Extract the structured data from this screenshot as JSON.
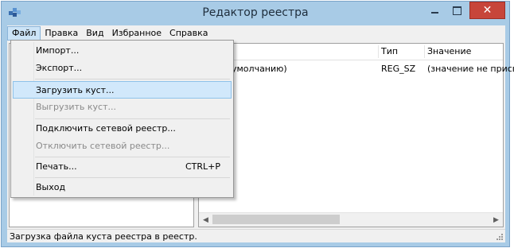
{
  "window": {
    "title": "Редактор реестра"
  },
  "menubar": {
    "items": [
      "Файл",
      "Правка",
      "Вид",
      "Избранное",
      "Справка"
    ]
  },
  "file_menu": {
    "import": "Импорт...",
    "export": "Экспорт...",
    "load_hive": "Загрузить куст...",
    "unload_hive": "Выгрузить куст...",
    "connect_network": "Подключить сетевой реестр...",
    "disconnect_network": "Отключить сетевой реестр...",
    "print": "Печать...",
    "print_shortcut": "CTRL+P",
    "exit": "Выход"
  },
  "list": {
    "columns": {
      "type": "Тип",
      "value": "Значение"
    },
    "rows": [
      {
        "name": "умолчанию)",
        "type": "REG_SZ",
        "value": "(значение не присв"
      }
    ]
  },
  "statusbar": {
    "text": "Загрузка файла куста реестра в реестр."
  },
  "colors": {
    "frame": "#a8cbe6",
    "close_button": "#c7453a",
    "highlight": "#d1e8fb"
  },
  "icons": [
    "registry-editor-icon",
    "minimize-icon",
    "maximize-icon",
    "close-icon",
    "scroll-left-arrow-icon",
    "scroll-right-arrow-icon",
    "size-grip-icon"
  ]
}
